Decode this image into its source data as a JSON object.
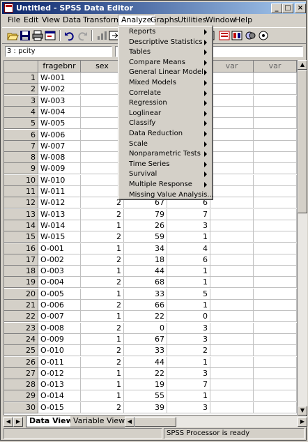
{
  "window": {
    "title": "Untitled - SPSS Data Editor",
    "controls": [
      "_",
      "□",
      "×"
    ]
  },
  "menu": [
    "File",
    "Edit",
    "View",
    "Data",
    "Transform",
    "Analyze",
    "Graphs",
    "Utilities",
    "Window",
    "Help"
  ],
  "active_menu": "Analyze",
  "toolbar_icons": [
    "open-icon",
    "save-icon",
    "print-icon",
    "dialog-recall-icon",
    "undo-icon",
    "redo-icon",
    "goto-chart-icon",
    "goto-case-icon",
    "variables-icon",
    "find-icon",
    "insert-case-icon",
    "insert-variable-icon",
    "split-file-icon",
    "weight-cases-icon",
    "select-cases-icon",
    "value-labels-icon",
    "use-sets-icon"
  ],
  "cell_editor": {
    "reference": "3 : pcity",
    "value": ""
  },
  "columns": [
    "fragebnr",
    "sex",
    "",
    "",
    "var",
    "var"
  ],
  "rows": [
    {
      "n": "1",
      "id": "W-001",
      "sex": "",
      "age": "",
      "city": ""
    },
    {
      "n": "2",
      "id": "W-002",
      "sex": "",
      "age": "",
      "city": ""
    },
    {
      "n": "3",
      "id": "W-003",
      "sex": "",
      "age": "",
      "city": ""
    },
    {
      "n": "4",
      "id": "W-004",
      "sex": "",
      "age": "",
      "city": ""
    },
    {
      "n": "5",
      "id": "W-005",
      "sex": "",
      "age": "",
      "city": ""
    },
    {
      "n": "6",
      "id": "W-006",
      "sex": "",
      "age": "",
      "city": ""
    },
    {
      "n": "7",
      "id": "W-007",
      "sex": "",
      "age": "",
      "city": ""
    },
    {
      "n": "8",
      "id": "W-008",
      "sex": "",
      "age": "",
      "city": ""
    },
    {
      "n": "9",
      "id": "W-009",
      "sex": "",
      "age": "",
      "city": ""
    },
    {
      "n": "10",
      "id": "W-010",
      "sex": "",
      "age": "",
      "city": ""
    },
    {
      "n": "11",
      "id": "W-011",
      "sex": "",
      "age": "",
      "city": ""
    },
    {
      "n": "12",
      "id": "W-012",
      "sex": "2",
      "age": "67",
      "city": "6"
    },
    {
      "n": "13",
      "id": "W-013",
      "sex": "2",
      "age": "79",
      "city": "7"
    },
    {
      "n": "14",
      "id": "W-014",
      "sex": "1",
      "age": "26",
      "city": "3"
    },
    {
      "n": "15",
      "id": "W-015",
      "sex": "2",
      "age": "59",
      "city": "1"
    },
    {
      "n": "16",
      "id": "O-001",
      "sex": "1",
      "age": "34",
      "city": "4"
    },
    {
      "n": "17",
      "id": "O-002",
      "sex": "2",
      "age": "18",
      "city": "6"
    },
    {
      "n": "18",
      "id": "O-003",
      "sex": "1",
      "age": "44",
      "city": "1"
    },
    {
      "n": "19",
      "id": "O-004",
      "sex": "2",
      "age": "68",
      "city": "1"
    },
    {
      "n": "20",
      "id": "O-005",
      "sex": "1",
      "age": "33",
      "city": "5"
    },
    {
      "n": "21",
      "id": "O-006",
      "sex": "2",
      "age": "66",
      "city": "1"
    },
    {
      "n": "22",
      "id": "O-007",
      "sex": "1",
      "age": "22",
      "city": "0"
    },
    {
      "n": "23",
      "id": "O-008",
      "sex": "2",
      "age": "0",
      "city": "3"
    },
    {
      "n": "24",
      "id": "O-009",
      "sex": "1",
      "age": "67",
      "city": "3"
    },
    {
      "n": "25",
      "id": "O-010",
      "sex": "2",
      "age": "33",
      "city": "2"
    },
    {
      "n": "26",
      "id": "O-011",
      "sex": "2",
      "age": "44",
      "city": "1"
    },
    {
      "n": "27",
      "id": "O-012",
      "sex": "1",
      "age": "22",
      "city": "3"
    },
    {
      "n": "28",
      "id": "O-013",
      "sex": "1",
      "age": "19",
      "city": "7"
    },
    {
      "n": "29",
      "id": "O-014",
      "sex": "1",
      "age": "55",
      "city": "1"
    },
    {
      "n": "30",
      "id": "O-015",
      "sex": "2",
      "age": "39",
      "city": "3"
    }
  ],
  "analyze_menu": [
    {
      "label": "Reports",
      "submenu": true
    },
    {
      "label": "Descriptive Statistics",
      "submenu": true
    },
    {
      "label": "Tables",
      "submenu": true
    },
    {
      "label": "Compare Means",
      "submenu": true
    },
    {
      "label": "General Linear Model",
      "submenu": true
    },
    {
      "label": "Mixed Models",
      "submenu": true
    },
    {
      "label": "Correlate",
      "submenu": true
    },
    {
      "label": "Regression",
      "submenu": true
    },
    {
      "label": "Loglinear",
      "submenu": true
    },
    {
      "label": "Classify",
      "submenu": true
    },
    {
      "label": "Data Reduction",
      "submenu": true
    },
    {
      "label": "Scale",
      "submenu": true
    },
    {
      "label": "Nonparametric Tests",
      "submenu": true
    },
    {
      "label": "Time Series",
      "submenu": true
    },
    {
      "label": "Survival",
      "submenu": true
    },
    {
      "label": "Multiple Response",
      "submenu": true
    },
    {
      "label": "Missing Value Analysis...",
      "submenu": false
    }
  ],
  "tabs": [
    "Data View",
    "Variable View"
  ],
  "active_tab": "Data View",
  "status": {
    "processor": "SPSS Processor  is ready"
  },
  "colors": {
    "title_gradient_start": "#0a246a",
    "title_gradient_end": "#a6caf0",
    "chrome": "#d4d0c8"
  }
}
